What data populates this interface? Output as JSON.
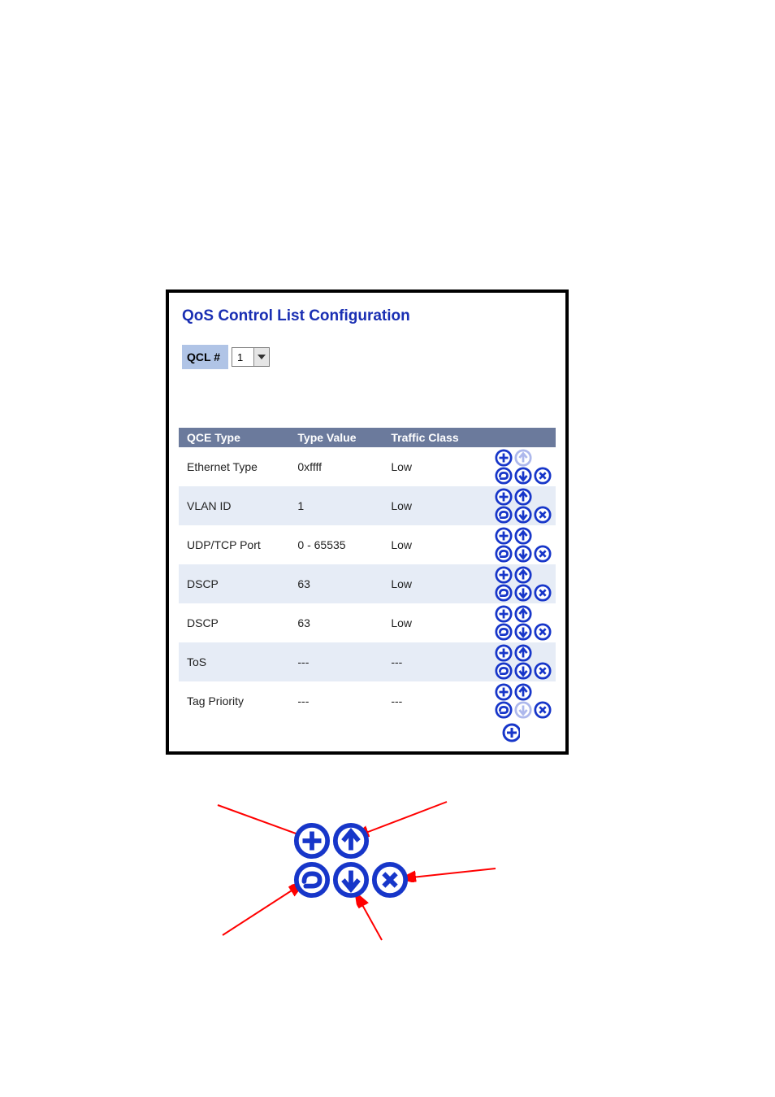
{
  "panel": {
    "title": "QoS Control List Configuration",
    "qcl_label": "QCL #",
    "qcl_value": "1"
  },
  "table": {
    "headers": {
      "type": "QCE Type",
      "value": "Type Value",
      "class": "Traffic Class"
    },
    "rows": [
      {
        "type": "Ethernet Type",
        "value": "0xffff",
        "class": "Low",
        "up_dim": true,
        "down_dim": false
      },
      {
        "type": "VLAN ID",
        "value": "1",
        "class": "Low",
        "up_dim": false,
        "down_dim": false
      },
      {
        "type": "UDP/TCP Port",
        "value": "0 - 65535",
        "class": "Low",
        "up_dim": false,
        "down_dim": false
      },
      {
        "type": "DSCP",
        "value": "63",
        "class": "Low",
        "up_dim": false,
        "down_dim": false
      },
      {
        "type": "DSCP",
        "value": "63",
        "class": "Low",
        "up_dim": false,
        "down_dim": false
      },
      {
        "type": "ToS",
        "value": "---",
        "class": "---",
        "up_dim": false,
        "down_dim": false
      },
      {
        "type": "Tag Priority",
        "value": "---",
        "class": "---",
        "up_dim": false,
        "down_dim": true
      }
    ]
  },
  "icons": {
    "add": "add-icon",
    "up": "move-up-icon",
    "edit": "edit-icon",
    "down": "move-down-icon",
    "delete": "delete-icon"
  },
  "colors": {
    "brand": "#1a2fb3",
    "header_bg": "#6b7a9c",
    "label_bg": "#b0c4e6",
    "row_even": "#e6ecf6",
    "icon_ring": "#1736c9",
    "arrow": "#ff0000"
  }
}
